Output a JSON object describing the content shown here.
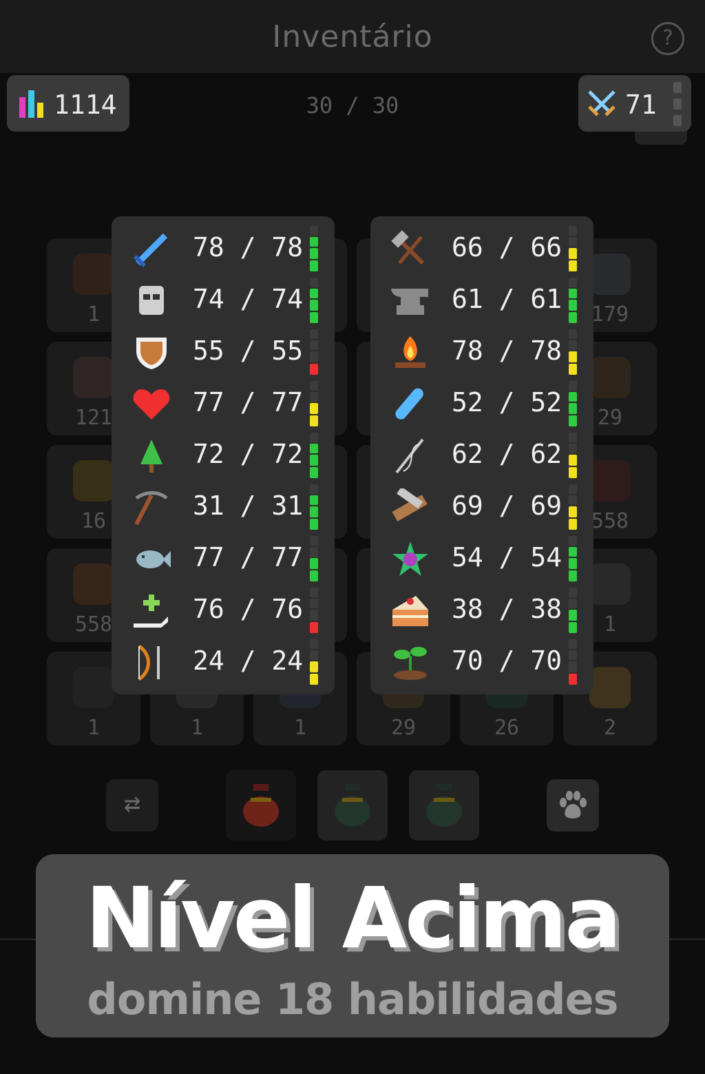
{
  "header": {
    "title": "Inventário",
    "help_icon": "question-circle-icon",
    "help_glyph": "?"
  },
  "stats": {
    "total_level": "1114",
    "total_icon": "bar-chart-icon",
    "slots": "30 / 30",
    "combat_level": "71",
    "combat_icon": "crossed-swords-icon"
  },
  "background_grid": {
    "counts": [
      "1",
      "",
      "",
      "",
      "",
      "179",
      "121",
      "",
      "",
      "",
      "",
      "29",
      "16",
      "",
      "",
      "",
      "",
      "558",
      "558",
      "",
      "",
      "",
      "",
      "1",
      "1",
      "1",
      "1",
      "29",
      "26",
      "2"
    ]
  },
  "skills_left": [
    {
      "icon": "sword-icon",
      "value": "78 / 78",
      "color": "#4fa8ff",
      "bar": "green3"
    },
    {
      "icon": "helmet-icon",
      "value": "74 / 74",
      "color": "#d0d0d0",
      "bar": "green3"
    },
    {
      "icon": "shield-icon",
      "value": "55 / 55",
      "color": "#c87a3a",
      "bar": "red1"
    },
    {
      "icon": "heart-icon",
      "value": "77 / 77",
      "color": "#f03030",
      "bar": "yellow2"
    },
    {
      "icon": "tree-icon",
      "value": "72 / 72",
      "color": "#3fbf4a",
      "bar": "green3"
    },
    {
      "icon": "pickaxe-icon",
      "value": "31 / 31",
      "color": "#a0522d",
      "bar": "green3"
    },
    {
      "icon": "fish-icon",
      "value": "77 / 77",
      "color": "#9ab8c8",
      "bar": "green2"
    },
    {
      "icon": "healing-hand-icon",
      "value": "76 / 76",
      "color": "#8ad85a",
      "bar": "red1"
    },
    {
      "icon": "bow-arrow-icon",
      "value": "24 / 24",
      "color": "#e08020",
      "bar": "yellow2"
    }
  ],
  "skills_right": [
    {
      "icon": "hammer-icon",
      "value": "66 / 66",
      "color": "#b0b0b0",
      "bar": "yellow2"
    },
    {
      "icon": "anvil-icon",
      "value": "61 / 61",
      "color": "#8a8a8a",
      "bar": "green3"
    },
    {
      "icon": "campfire-icon",
      "value": "78 / 78",
      "color": "#ff7a1a",
      "bar": "yellow2"
    },
    {
      "icon": "potion-vial-icon",
      "value": "52 / 52",
      "color": "#58b8ff",
      "bar": "green3"
    },
    {
      "icon": "needle-thread-icon",
      "value": "62 / 62",
      "color": "#c8c8c8",
      "bar": "yellow2"
    },
    {
      "icon": "saw-wood-icon",
      "value": "69 / 69",
      "color": "#b07a4a",
      "bar": "yellow2"
    },
    {
      "icon": "magic-gem-icon",
      "value": "54 / 54",
      "color": "#b040c0",
      "bar": "green3"
    },
    {
      "icon": "cake-icon",
      "value": "38 / 38",
      "color": "#e89050",
      "bar": "green2"
    },
    {
      "icon": "sprout-icon",
      "value": "70 / 70",
      "color": "#40c040",
      "bar": "red1"
    }
  ],
  "bottom_bar": {
    "swap_icon": "swap-arrows-icon",
    "swap_glyph": "⇄",
    "bags": [
      "red-bag-icon",
      "green-bag-icon",
      "green-bag-icon"
    ],
    "pet_icon": "paw-icon",
    "pet_glyph": "🐾"
  },
  "banner": {
    "title": "Nível Acima",
    "subtitle": "domine 18 habilidades"
  },
  "colors": {
    "green": "#2ecc40",
    "yellow": "#f0e020",
    "red": "#f03030",
    "empty": "#3c3c3c"
  }
}
